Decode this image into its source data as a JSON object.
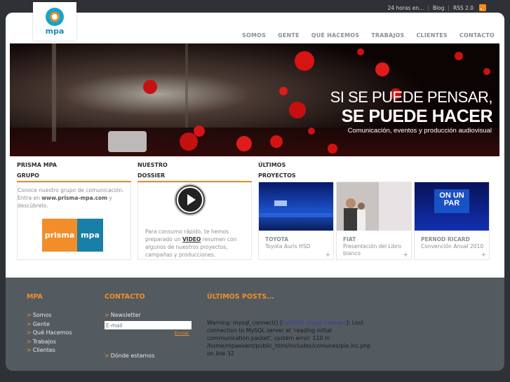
{
  "topbar": {
    "item1": "24 horas en...",
    "item2": "Blog",
    "item3": "RSS 2.0"
  },
  "logo": {
    "text": "mpa"
  },
  "nav": {
    "items": [
      "SOMOS",
      "GENTE",
      "QUÉ HACEMOS",
      "TRABAJOS",
      "CLIENTES",
      "CONTACTO"
    ]
  },
  "hero": {
    "line1": "SI SE PUEDE PENSAR,",
    "line2": "SE PUEDE HACER",
    "line3": "Comunicación, eventos y producción audiovisual"
  },
  "grupo": {
    "title1": "PRISMA MPA",
    "title2": "GRUPO",
    "text1": "Conoce nuestro grupo de comunicación. Entra en ",
    "link": "www.prisma-mpa.com",
    "text2": " y descúbrelo.",
    "logo_left": "prisma",
    "logo_right": "mpa"
  },
  "dossier": {
    "title1": "NUESTRO",
    "title2": "DOSSIER",
    "text1": "Para consumo rápido, te hemos preparado un ",
    "link": "VIDEO",
    "text2": " resumen con algunos de nuestros proyectos, campañas y producciones."
  },
  "projects": {
    "title1": "ÚLTIMOS",
    "title2": "PROYECTOS",
    "items": [
      {
        "name": "TOYOTA",
        "desc": "Toyota Auris HSD"
      },
      {
        "name": "FIAT",
        "desc": "Presentación del Libro blanco"
      },
      {
        "name": "PERNOD RICARD",
        "desc": "Convención Anual 2010",
        "screen_text": "ON UN PAR"
      }
    ],
    "plus": "+"
  },
  "footer": {
    "mpa_title": "MPA",
    "mpa_links": [
      "Somos",
      "Gente",
      "Qué Hacemos",
      "Trabajos",
      "Clientes"
    ],
    "contact_title": "CONTACTO",
    "newsletter": "Newsletter",
    "email_placeholder": "E-mail",
    "send": "Enviar",
    "donde": "Dónde estamos",
    "posts_title": "ÚLTIMOS POSTS...",
    "warning_pre": "Warning: mysql_connect() [",
    "warning_fn": "function.mysql-connect",
    "warning_post": "]: Lost connection to MySQL server at 'reading initial communication packet', system error: 110 in /home/mpaevent/public_html/includes/comunes/pie.inc.php on line 32"
  },
  "colors": {
    "accent": "#f18e2a",
    "brand_blue": "#1a8fb3",
    "footer_bg": "#545b60"
  }
}
